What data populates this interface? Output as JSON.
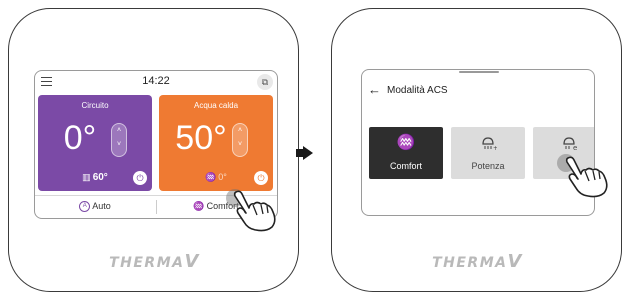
{
  "left_panel": {
    "time": "14:22",
    "cards": [
      {
        "title": "Circuito",
        "temperature": "0°",
        "sub_icon": "floor-heating-icon",
        "sub_value": "60°",
        "color": "#7b4aa6"
      },
      {
        "title": "Acqua calda",
        "temperature": "50°",
        "sub_icon": "shower-icon",
        "sub_value": "0°",
        "color": "#ef7a32"
      }
    ],
    "modes": [
      {
        "label": "Auto",
        "icon": "auto-icon"
      },
      {
        "label": "Comfort",
        "icon": "shower-icon"
      }
    ]
  },
  "right_panel": {
    "title": "Modalità ACS",
    "tiles": [
      {
        "label": "Comfort",
        "icon": "shower-icon",
        "selected": true
      },
      {
        "label": "Potenza",
        "icon": "shower-plus-icon",
        "selected": false
      },
      {
        "label": "",
        "icon": "shower-eco-icon",
        "selected": false
      }
    ]
  },
  "brand": {
    "text": "THERMA",
    "suffix": "V"
  },
  "glyphs": {
    "up": "˄",
    "down": "˅",
    "power": "⏻",
    "back": "←",
    "note": "⧉",
    "shower": "♒",
    "auto": "A"
  }
}
